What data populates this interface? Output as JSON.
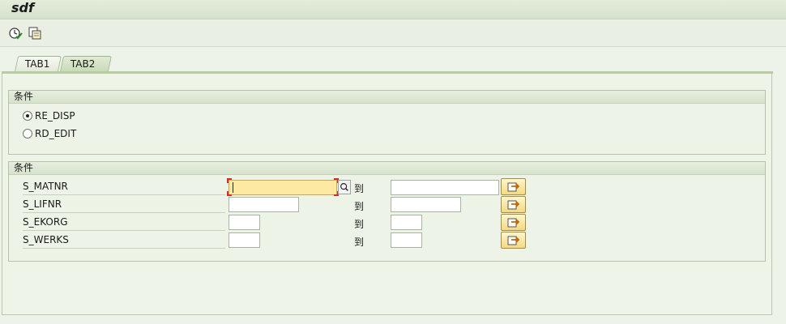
{
  "window": {
    "title": "sdf"
  },
  "toolbar": {
    "icons": [
      "execute-icon",
      "variant-icon"
    ]
  },
  "tabs": [
    {
      "label": "TAB1",
      "active": false
    },
    {
      "label": "TAB2",
      "active": true
    }
  ],
  "group1": {
    "title": "条件",
    "radios": [
      {
        "label": "RE_DISP",
        "checked": true
      },
      {
        "label": "RD_EDIT",
        "checked": false
      }
    ]
  },
  "group2": {
    "title": "条件",
    "to_label": "到",
    "rows": [
      {
        "label": "S_MATNR",
        "low": "",
        "high": ""
      },
      {
        "label": "S_LIFNR",
        "low": "",
        "high": ""
      },
      {
        "label": "S_EKORG",
        "low": "",
        "high": ""
      },
      {
        "label": "S_WERKS",
        "low": "",
        "high": ""
      }
    ]
  },
  "colors": {
    "focus_field": "#fde9a2",
    "multi_button": "#f3d981",
    "background": "#eef3e9"
  }
}
